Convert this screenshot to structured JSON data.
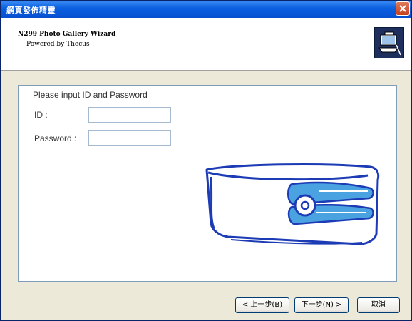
{
  "window": {
    "title": "網頁發佈精靈"
  },
  "header": {
    "title": "N299 Photo Gallery Wizard",
    "subtitle": "Powered by Thecus"
  },
  "form": {
    "prompt": "Please input ID and Password",
    "id_label": "ID :",
    "id_value": "",
    "password_label": "Password :",
    "password_value": ""
  },
  "buttons": {
    "back": "< 上一步(B)",
    "next": "下一步(N) >",
    "cancel": "取消"
  },
  "colors": {
    "titlebar": "#0a5fe0",
    "accent_blue": "#1c3bb5",
    "drive_highlight": "#4aa3e0"
  },
  "icons": {
    "close": "close-icon",
    "wizard": "wizard-network-icon",
    "illustration": "nas-drive-illustration"
  }
}
